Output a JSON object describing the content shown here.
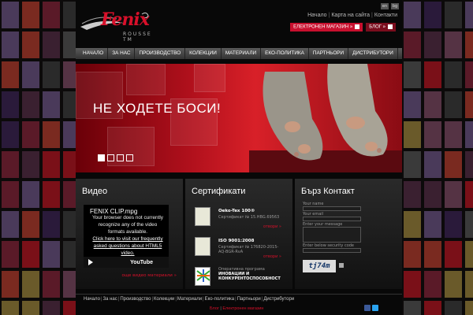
{
  "brand": {
    "name": "Fenix",
    "sub": "ROUSSE TM"
  },
  "lang": [
    "en",
    "bg"
  ],
  "top_links": [
    "Начало",
    "Карта на сайта",
    "Контакти"
  ],
  "shop_buttons": {
    "shop": "ЕЛЕКТРОНЕН МАГАЗИН »",
    "blog": "БЛОГ »"
  },
  "nav": [
    "НАЧАЛО",
    "ЗА НАС",
    "ПРОИЗВОДСТВО",
    "КОЛЕКЦИИ",
    "МАТЕРИАЛИ",
    "ЕКО-ПОЛИТИКА",
    "ПАРТНЬОРИ",
    "ДИСТРИБУТОРИ"
  ],
  "banner": {
    "title": "НЕ ХОДЕТЕ БОСИ!",
    "slides": 4,
    "active_slide": 1
  },
  "video": {
    "heading": "Видео",
    "file": "FENIX CLIP.mpg",
    "message": "Your browser does not currently recognize any of the video formats available.",
    "link": "Click here to visit our frequently asked questions about HTML5 video.",
    "player_logo": "YouTube",
    "more": "още видео материали »"
  },
  "certs": {
    "heading": "Сертификати",
    "items": [
      {
        "name": "Oeko-Tex 100®",
        "number": "Сертификат № 15.HBG.69563",
        "more": "отвори »"
      },
      {
        "name": "ISO 9001:2008",
        "number": "Сертификат № 176820-2015-AQ-BGR-RvA",
        "more": "отвори »"
      },
      {
        "name": "Оперативна програма",
        "number": "ИНОВАЦИИ И КОНКУРЕНТОСПОСОБНОСТ",
        "more": ""
      }
    ]
  },
  "contact": {
    "heading": "Бърз Контакт",
    "fields": [
      "Your name",
      "Your email",
      "Enter your message",
      "Enter below security code"
    ],
    "captcha": "tj74m"
  },
  "footer": {
    "links": [
      "Начало",
      "За нас",
      "Производство",
      "Колекции",
      "Материали",
      "Еко-политика",
      "Партньори",
      "Дистрибутори"
    ],
    "blog": "Блог",
    "shop": "Електронен магазин"
  }
}
